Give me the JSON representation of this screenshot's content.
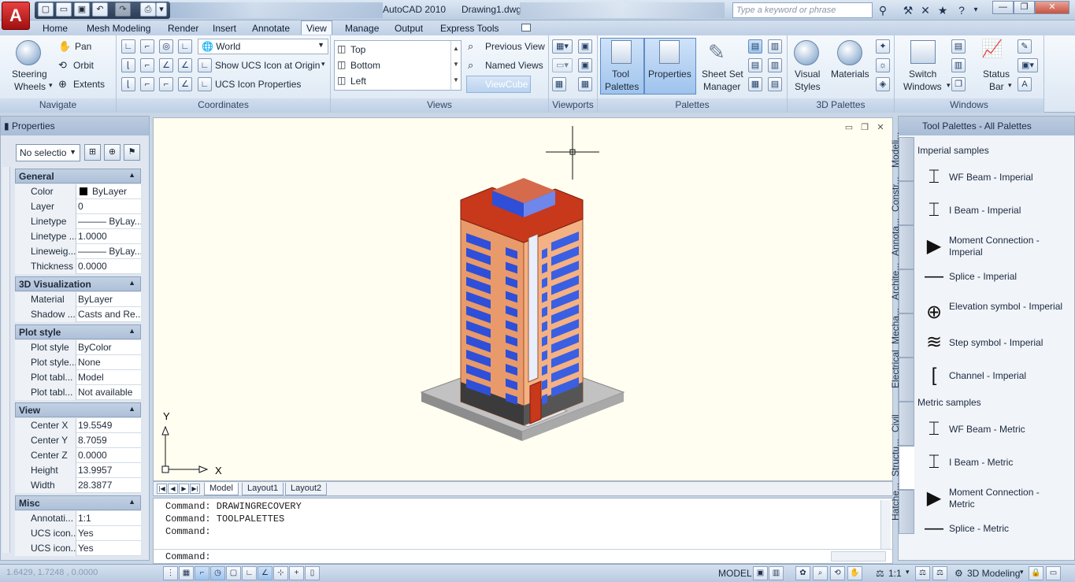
{
  "window": {
    "app_title": "AutoCAD 2010",
    "doc_title": "Drawing1.dwg",
    "search_placeholder": "Type a keyword or phrase",
    "app_logo": "A"
  },
  "menu_tabs": [
    "Home",
    "Mesh Modeling",
    "Render",
    "Insert",
    "Annotate",
    "View",
    "Manage",
    "Output",
    "Express Tools"
  ],
  "active_tab": "View",
  "ribbon": {
    "navigate": {
      "label": "Navigate",
      "steering": "Steering",
      "wheels": "Wheels",
      "pan": "Pan",
      "orbit": "Orbit",
      "extents": "Extents"
    },
    "coordinates": {
      "label": "Coordinates",
      "world": "World",
      "show_ucs": "Show UCS Icon at Origin",
      "ucs_props": "UCS Icon Properties"
    },
    "views": {
      "label": "Views",
      "items": [
        "Top",
        "Bottom",
        "Left"
      ],
      "previous": "Previous View",
      "named": "Named Views",
      "viewcube": "ViewCube"
    },
    "viewports": {
      "label": "Viewports"
    },
    "palettes": {
      "label": "Palettes",
      "tool": "Tool",
      "palettes_word": "Palettes",
      "properties": "Properties",
      "sheetset": "Sheet Set",
      "manager": "Manager"
    },
    "palettes3d": {
      "label": "3D Palettes",
      "visual": "Visual",
      "styles": "Styles",
      "materials": "Materials"
    },
    "windows": {
      "label": "Windows",
      "switch": "Switch",
      "windows_word": "Windows",
      "status": "Status",
      "bar": "Bar"
    }
  },
  "properties": {
    "title": "Properties",
    "selection": "No selectio",
    "sections": [
      {
        "name": "General",
        "rows": [
          [
            "Color",
            "ByLayer"
          ],
          [
            "Layer",
            "0"
          ],
          [
            "Linetype",
            "——— ByLay..."
          ],
          [
            "Linetype ...",
            "1.0000"
          ],
          [
            "Lineweig...",
            "——— ByLay..."
          ],
          [
            "Thickness",
            "0.0000"
          ]
        ]
      },
      {
        "name": "3D Visualization",
        "rows": [
          [
            "Material",
            "ByLayer"
          ],
          [
            "Shadow ...",
            "Casts and Re..."
          ]
        ]
      },
      {
        "name": "Plot style",
        "rows": [
          [
            "Plot style",
            "ByColor"
          ],
          [
            "Plot style...",
            "None"
          ],
          [
            "Plot tabl...",
            "Model"
          ],
          [
            "Plot tabl...",
            "Not available"
          ]
        ]
      },
      {
        "name": "View",
        "rows": [
          [
            "Center X",
            "19.5549"
          ],
          [
            "Center Y",
            "8.7059"
          ],
          [
            "Center Z",
            "0.0000"
          ],
          [
            "Height",
            "13.9957"
          ],
          [
            "Width",
            "28.3877"
          ]
        ]
      },
      {
        "name": "Misc",
        "rows": [
          [
            "Annotati...",
            "1:1"
          ],
          [
            "UCS icon...",
            "Yes"
          ],
          [
            "UCS icon...",
            "Yes"
          ]
        ]
      }
    ]
  },
  "drawing": {
    "axis_y": "Y",
    "axis_x": "X",
    "layout_tabs": [
      "Model",
      "Layout1",
      "Layout2"
    ]
  },
  "command": {
    "lines": [
      "Command: DRAWINGRECOVERY",
      "Command: TOOLPALETTES",
      "Command:"
    ],
    "prompt": "Command:"
  },
  "tool_palettes": {
    "title": "Tool Palettes - All Palettes",
    "tabs": [
      "Modeli...",
      "Constr...",
      "Annota...",
      "Archite...",
      "Mecha...",
      "Electrical",
      "Civil",
      "Structu...",
      "Hatche..."
    ],
    "active_tab": "Structu...",
    "groups": [
      {
        "name": "Imperial samples",
        "items": [
          "WF Beam - Imperial",
          "I Beam - Imperial",
          "Moment Connection - Imperial",
          "Splice - Imperial",
          "Elevation symbol - Imperial",
          "Step symbol - Imperial",
          "Channel - Imperial"
        ]
      },
      {
        "name": "Metric samples",
        "items": [
          "WF Beam - Metric",
          "I Beam - Metric",
          "Moment Connection - Metric",
          "Splice - Metric"
        ]
      }
    ]
  },
  "statusbar": {
    "coords": "1.6429,  1.7248 , 0.0000",
    "model": "MODEL",
    "scale": "1:1",
    "workspace": "3D Modeling"
  },
  "colors": {
    "accent": "#3a6ea5",
    "roof": "#c8381b",
    "wall": "#e89a6a",
    "glass": "#2f4fd8"
  }
}
